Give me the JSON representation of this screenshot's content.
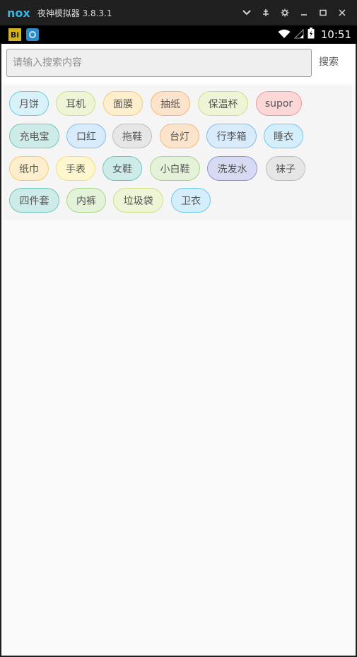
{
  "window": {
    "title": "夜神模拟器 3.8.3.1",
    "logo_text": "nox"
  },
  "statusbar": {
    "app_badge": "Bi",
    "time": "10:51"
  },
  "search": {
    "placeholder": "请输入搜索内容",
    "value": "",
    "button_label": "搜索"
  },
  "tags": [
    {
      "label": "月饼",
      "bg": "#d9f1f8",
      "border": "#6ccbe0"
    },
    {
      "label": "耳机",
      "bg": "#eef4d6",
      "border": "#cfe08a"
    },
    {
      "label": "面膜",
      "bg": "#fdeecd",
      "border": "#f6cd6e"
    },
    {
      "label": "抽纸",
      "bg": "#fbe3cc",
      "border": "#f4b879"
    },
    {
      "label": "保温杯",
      "bg": "#eef4d6",
      "border": "#cfe08a"
    },
    {
      "label": "supor",
      "bg": "#fbd7d7",
      "border": "#f29a9a"
    },
    {
      "label": "充电宝",
      "bg": "#cdebe8",
      "border": "#6fc6bd"
    },
    {
      "label": "口红",
      "bg": "#d7ebfb",
      "border": "#7fbef0"
    },
    {
      "label": "拖鞋",
      "bg": "#e6e6e6",
      "border": "#bdbdbd"
    },
    {
      "label": "台灯",
      "bg": "#fbe3cc",
      "border": "#f4b879"
    },
    {
      "label": "行李箱",
      "bg": "#d7ebfb",
      "border": "#7fbef0"
    },
    {
      "label": "睡衣",
      "bg": "#d4eefb",
      "border": "#6fc9ef"
    },
    {
      "label": "纸巾",
      "bg": "#fdeecd",
      "border": "#f6cd6e"
    },
    {
      "label": "手表",
      "bg": "#fdf6cf",
      "border": "#f3e07a"
    },
    {
      "label": "女鞋",
      "bg": "#cdebe8",
      "border": "#6fc6bd"
    },
    {
      "label": "小白鞋",
      "bg": "#e4f2da",
      "border": "#a8d68a"
    },
    {
      "label": "洗发水",
      "bg": "#d6daf2",
      "border": "#8d97d8"
    },
    {
      "label": "袜子",
      "bg": "#e6e6e6",
      "border": "#bdbdbd"
    },
    {
      "label": "四件套",
      "bg": "#cdebe8",
      "border": "#6fc6bd"
    },
    {
      "label": "内裤",
      "bg": "#e4f2da",
      "border": "#a8d68a"
    },
    {
      "label": "垃圾袋",
      "bg": "#eef4d6",
      "border": "#cfe08a"
    },
    {
      "label": "卫衣",
      "bg": "#d4eefb",
      "border": "#6fc9ef"
    }
  ]
}
